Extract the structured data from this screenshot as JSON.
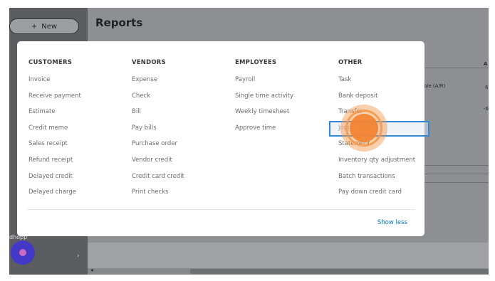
{
  "header": {
    "page_title": "Reports",
    "new_label": "New",
    "new_icon": "plus-icon"
  },
  "leftnav": {
    "partial_label": "(hidden)",
    "item_label": "Accounting (partial)"
  },
  "background": {
    "col_header": "A",
    "row_label": "ble (A/R)",
    "value1": "6",
    "value2": "-6"
  },
  "menu": {
    "columns": [
      {
        "heading": "CUSTOMERS",
        "items": [
          "Invoice",
          "Receive payment",
          "Estimate",
          "Credit memo",
          "Sales receipt",
          "Refund receipt",
          "Delayed credit",
          "Delayed charge"
        ]
      },
      {
        "heading": "VENDORS",
        "items": [
          "Expense",
          "Check",
          "Bill",
          "Pay bills",
          "Purchase order",
          "Vendor credit",
          "Credit card credit",
          "Print checks"
        ]
      },
      {
        "heading": "EMPLOYEES",
        "items": [
          "Payroll",
          "Single time activity",
          "Weekly timesheet",
          "Approve time"
        ]
      },
      {
        "heading": "OTHER",
        "items": [
          "Task",
          "Bank deposit",
          "Transfer",
          "Journal entry",
          "Statement",
          "Inventory qty adjustment",
          "Batch transactions",
          "Pay down credit card"
        ]
      }
    ],
    "show_less_label": "Show less"
  },
  "colors": {
    "accent": "#0077c5",
    "highlight_border": "#2f88d8",
    "click_marker": "#f28534",
    "overlay": "#8d8f93"
  }
}
